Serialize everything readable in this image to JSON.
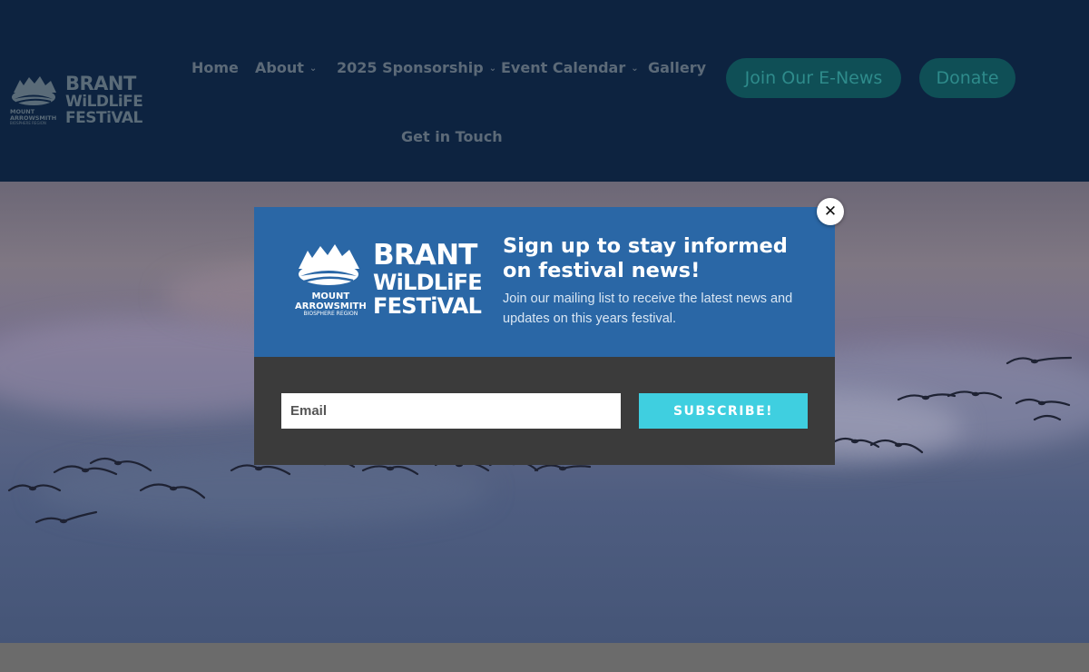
{
  "header": {
    "logo": {
      "alt": "Brant Wildlife Festival",
      "brand_line1": "BRANT",
      "brand_line2": "WiLDLiFE",
      "brand_line3": "FESTiVAL",
      "org_line1": "MOUNT",
      "org_line2": "ARROWSMITH",
      "org_line3": "BIOSPHERE REGION"
    },
    "nav": [
      {
        "label": "Home",
        "has_dropdown": false
      },
      {
        "label": "About",
        "has_dropdown": true
      },
      {
        "label": "2025 Sponsorship",
        "has_dropdown": true
      },
      {
        "label": "Event Calendar",
        "has_dropdown": true
      },
      {
        "label": "Gallery",
        "has_dropdown": false
      },
      {
        "label": "Get in Touch",
        "has_dropdown": false
      }
    ],
    "chevron": "⌄",
    "cta_enews": "Join Our E-News",
    "cta_donate": "Donate"
  },
  "popup": {
    "title": "Sign up to stay informed on festival news!",
    "description": "Join our mailing list to receive the latest news and updates on this years festival.",
    "email_placeholder": "Email",
    "subscribe_label": "SUBSCRIBE!",
    "close_label": "✕"
  },
  "colors": {
    "header_bg": "#0d2340",
    "popup_top": "#2a67a6",
    "popup_bottom": "#3b3b3b",
    "subscribe_bg": "#3fcfe0",
    "pill_bg": "#0f4f56"
  }
}
